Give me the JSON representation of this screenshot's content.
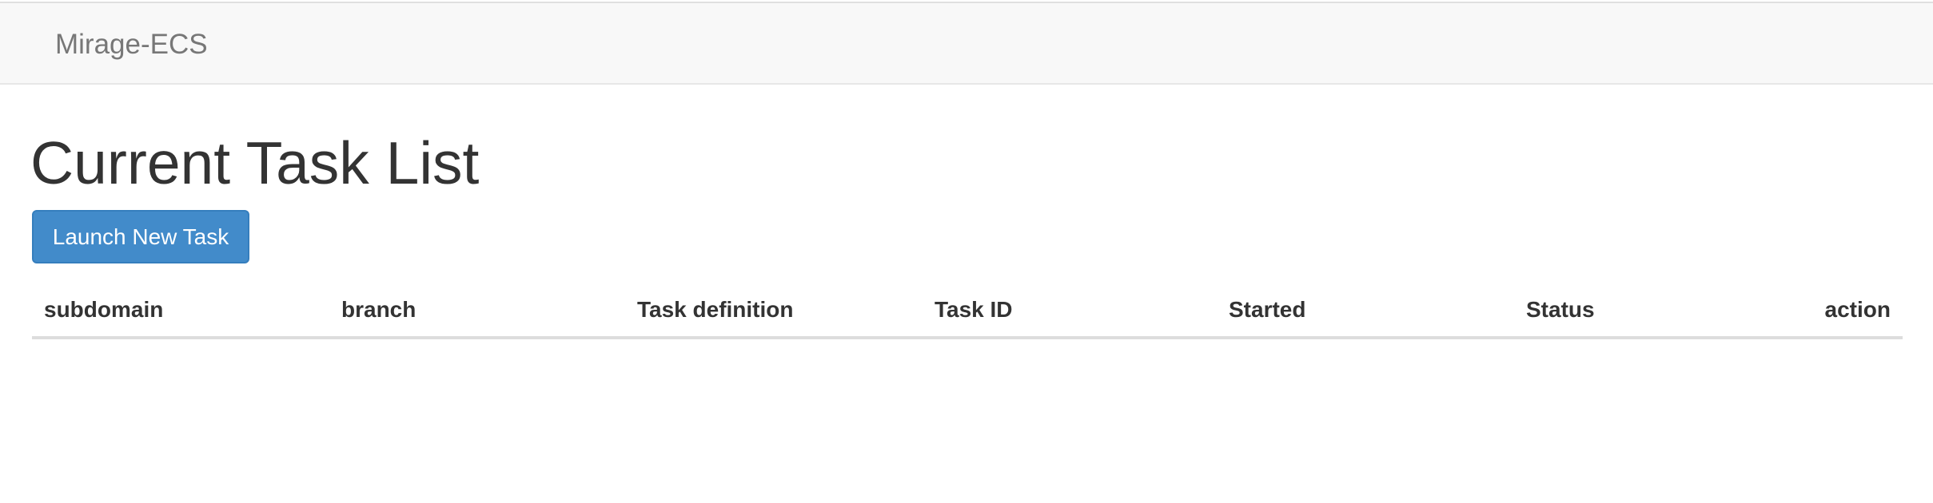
{
  "navbar": {
    "brand": "Mirage-ECS"
  },
  "main": {
    "title": "Current Task List",
    "launch_button_label": "Launch New Task"
  },
  "task_table": {
    "columns": [
      "subdomain",
      "branch",
      "Task definition",
      "Task ID",
      "Started",
      "Status",
      "action"
    ],
    "rows": []
  },
  "colors": {
    "navbar_bg": "#f8f8f8",
    "brand_text": "#777777",
    "primary_button": "#428bca",
    "text": "#333333"
  }
}
